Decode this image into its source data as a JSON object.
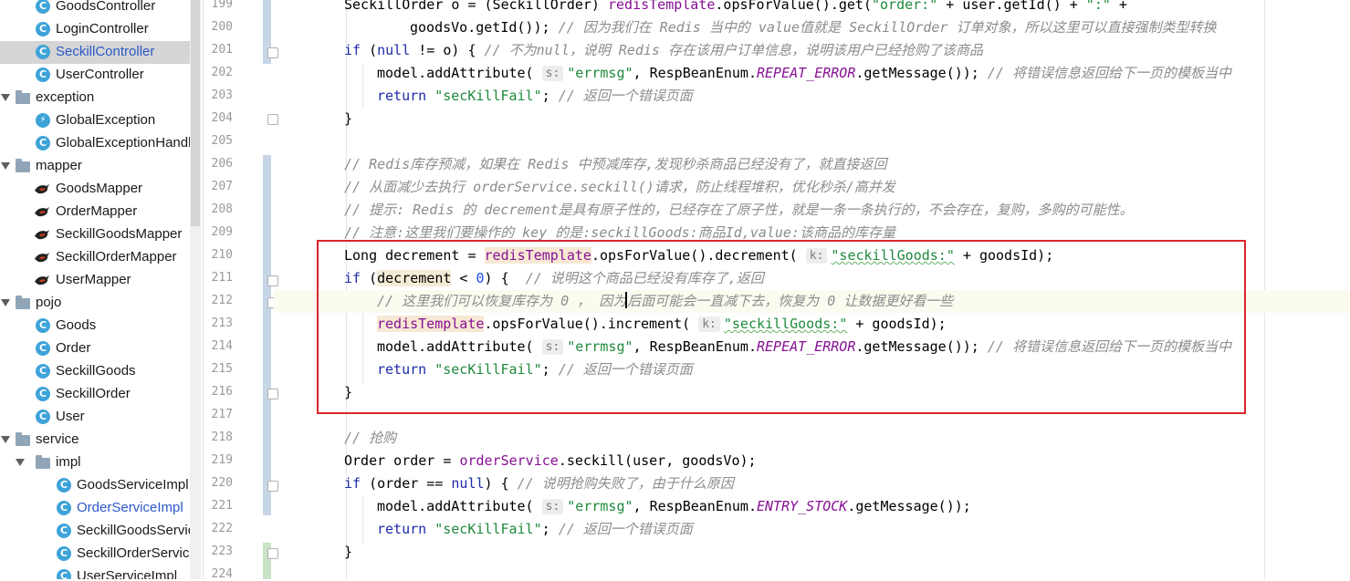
{
  "project_tree": {
    "items": [
      {
        "label": "GoodsController",
        "type": "class"
      },
      {
        "label": "LoginController",
        "type": "class"
      },
      {
        "label": "SeckillController",
        "type": "class",
        "selected": true
      },
      {
        "label": "UserController",
        "type": "class"
      },
      {
        "label": "exception",
        "type": "folder"
      },
      {
        "label": "GlobalException",
        "type": "exception-class"
      },
      {
        "label": "GlobalExceptionHandl",
        "type": "class"
      },
      {
        "label": "mapper",
        "type": "folder"
      },
      {
        "label": "GoodsMapper",
        "type": "mapper"
      },
      {
        "label": "OrderMapper",
        "type": "mapper"
      },
      {
        "label": "SeckillGoodsMapper",
        "type": "mapper"
      },
      {
        "label": "SeckillOrderMapper",
        "type": "mapper"
      },
      {
        "label": "UserMapper",
        "type": "mapper"
      },
      {
        "label": "pojo",
        "type": "folder"
      },
      {
        "label": "Goods",
        "type": "class"
      },
      {
        "label": "Order",
        "type": "class"
      },
      {
        "label": "SeckillGoods",
        "type": "class"
      },
      {
        "label": "SeckillOrder",
        "type": "class"
      },
      {
        "label": "User",
        "type": "class"
      },
      {
        "label": "service",
        "type": "folder"
      },
      {
        "label": "impl",
        "type": "folder"
      },
      {
        "label": "GoodsServiceImpl",
        "type": "class"
      },
      {
        "label": "OrderServiceImpl",
        "type": "class",
        "modified": true
      },
      {
        "label": "SeckillGoodsServic",
        "type": "class"
      },
      {
        "label": "SeckillOrderServic",
        "type": "class"
      },
      {
        "label": "UserServiceImpl",
        "type": "class"
      }
    ]
  },
  "editor": {
    "line_numbers": [
      "199",
      "200",
      "201",
      "202",
      "203",
      "204",
      "205",
      "206",
      "207",
      "208",
      "209",
      "210",
      "211",
      "212",
      "213",
      "214",
      "215",
      "216",
      "217",
      "218",
      "219",
      "220",
      "221",
      "222",
      "223",
      "224"
    ],
    "code": {
      "l199": {
        "a": "SeckillOrder o = (SeckillOrder) ",
        "b": "redisTemplate",
        "c": ".opsForValue().get(",
        "d": "\"order:\"",
        "e": " + user.getId() + ",
        "f": "\":\"",
        "g": " +"
      },
      "l200": {
        "a": "goodsVo.getId()); ",
        "b": "// 因为我们在 Redis 当中的 value值就是 SeckillOrder 订单对象，所以这里可以直接强制类型转换"
      },
      "l201": {
        "a": "if",
        "b": " (",
        "c": "null",
        "d": " != o) { ",
        "e": "// 不为null，说明 Redis 存在该用户订单信息，说明该用户已经抢购了该商品"
      },
      "l202": {
        "a": "model.addAttribute( ",
        "hint": "s:",
        "b": "\"errmsg\"",
        "c": ", RespBeanEnum.",
        "d": "REPEAT_ERROR",
        "e": ".getMessage()); ",
        "f": "// 将错误信息返回给下一页的模板当中"
      },
      "l203": {
        "a": "return",
        "b": " ",
        "c": "\"secKillFail\"",
        "d": "; ",
        "e": "// 返回一个错误页面"
      },
      "l204": {
        "a": "}"
      },
      "l206": {
        "a": "// Redis库存预减，如果在 Redis 中预减库存,发现秒杀商品已经没有了，就直接返回"
      },
      "l207": {
        "a": "// 从面减少去执行 orderService.seckill()请求，防止线程堆积，优化秒杀/高并发"
      },
      "l208": {
        "a": "// 提示: Redis 的 decrement是具有原子性的，已经存在了原子性，就是一条一条执行的，不会存在，复购，多购的可能性。"
      },
      "l209": {
        "a": "// 注意:这里我们要操作的 key 的是:seckillGoods:商品Id,value:该商品的库存量"
      },
      "l210": {
        "a": "Long decrement = ",
        "b": "redisTemplate",
        "c": ".opsForValue().decrement( ",
        "hint": "k:",
        "d": "\"seckillGoods:\"",
        "e": " + goodsId);"
      },
      "l211": {
        "a": "if",
        "b": " (",
        "c": "decrement",
        "d": " < ",
        "e": "0",
        "f": ") {  ",
        "g": "// 说明这个商品已经没有库存了,返回"
      },
      "l212": {
        "a": "// 这里我们可以恢复库存为 0 ， 因为",
        "b": "后面可能会一直减下去，恢复为 0 让数据更好看一些"
      },
      "l213": {
        "a": "redisTemplate",
        "b": ".opsForValue().increment( ",
        "hint": "k:",
        "c": "\"seckillGoods:\"",
        "d": " + goodsId);"
      },
      "l214": {
        "a": "model.addAttribute( ",
        "hint": "s:",
        "b": "\"errmsg\"",
        "c": ", RespBeanEnum.",
        "d": "REPEAT_ERROR",
        "e": ".getMessage()); ",
        "f": "// 将错误信息返回给下一页的模板当中"
      },
      "l215": {
        "a": "return",
        "b": " ",
        "c": "\"secKillFail\"",
        "d": "; ",
        "e": "// 返回一个错误页面"
      },
      "l216": {
        "a": "}"
      },
      "l218": {
        "a": "// 抢购"
      },
      "l219": {
        "a": "Order order = ",
        "b": "orderService",
        "c": ".seckill(user, goodsVo);"
      },
      "l220": {
        "a": "if",
        "b": " (order == ",
        "c": "null",
        "d": ") { ",
        "e": "// 说明抢购失败了，由于什么原因"
      },
      "l221": {
        "a": "model.addAttribute( ",
        "hint": "s:",
        "b": "\"errmsg\"",
        "c": ", RespBeanEnum.",
        "d": "ENTRY_STOCK",
        "e": ".getMessage());"
      },
      "l222": {
        "a": "return",
        "b": " ",
        "c": "\"secKillFail\"",
        "d": "; ",
        "e": "// 返回一个错误页面"
      },
      "l223": {
        "a": "}"
      }
    }
  },
  "colors": {
    "highlight_box": "#d9252d",
    "selected_tree_item": "#d5d5d5",
    "keyword": "#1d2aa8",
    "string": "#1e8a3c",
    "comment": "#8c8c8c",
    "field": "#871094",
    "vcs_modified": "#c7d6e7",
    "vcs_added": "#c9e3c6"
  }
}
